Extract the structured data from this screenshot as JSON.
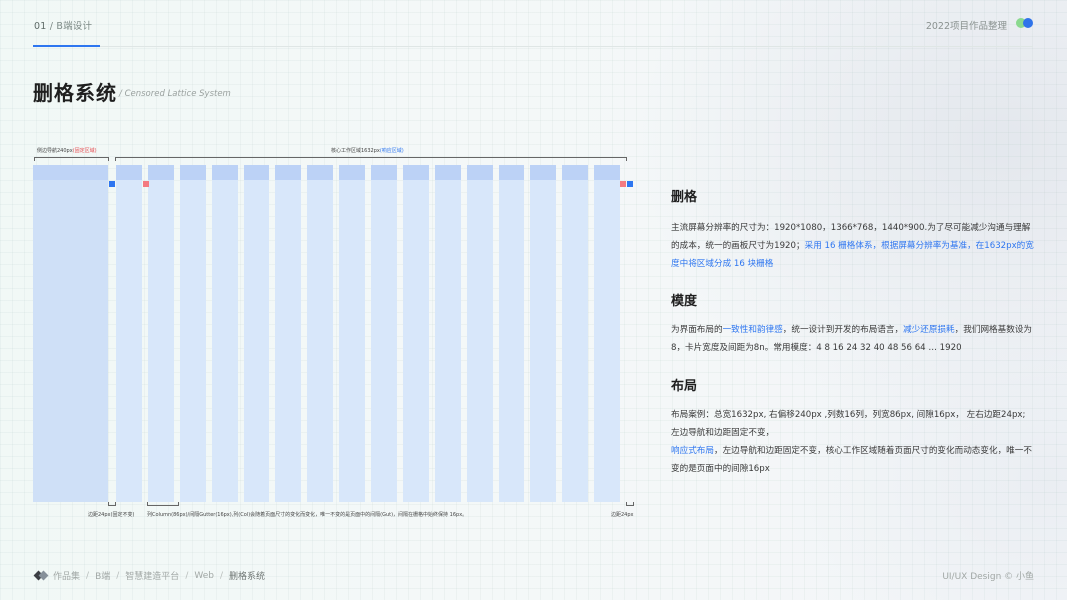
{
  "header": {
    "section_num": "01",
    "section_sep": "/",
    "section_name": "B端设计",
    "project": "2022项目作品整理",
    "accent_color": "#2e76f0"
  },
  "title": {
    "main": "删格系统",
    "sub": "/ Censored Lattice System"
  },
  "diagram": {
    "sidebar_label": "侧边导航240px",
    "sidebar_tag": "(固定区域)",
    "core_label": "核心工作区域1632px",
    "core_tag": "(响应区域)",
    "margin_left_label": "边距24px(固定不变)",
    "column_note": "列Column(86px)/间隔Gutter(16px),列(Col)会随着页面尺寸的变化而变化，唯一不变的是页面中的间隔(Gut)，间隔在栅格中始终保持 16px。",
    "margin_right_label": "边距24px",
    "columns": 16,
    "colors": {
      "sidebar": "#cfe0f7",
      "column": "#d8e7fa",
      "header": "#bcd2f6",
      "marker_blue": "#2e76f0",
      "marker_red": "#f47a80"
    }
  },
  "sections": [
    {
      "title": "删格",
      "p1": "主流屏幕分辨率的尺寸为：1920*1080，1366*768，1440*900.为了尽可能减少沟通与理解的成本，统一的画板尺寸为1920；",
      "p1_hl": "采用 16 栅格体系，根据屏幕分辨率为基准，在1632px的宽度中将区域分成 16 块栅格"
    },
    {
      "title": "模度",
      "p1": "为界面布局的",
      "p1_hl": "一致性和韵律感",
      "p2": "，统一设计到开发的布局语言，",
      "p2_hl": "减少还原损耗",
      "p3": "，我们网格基数设为8，卡片宽度及间距为8n。常用模度：4 8  16  24  32  40   48  56  64   …  1920"
    },
    {
      "title": "布局",
      "p1": "布局案例：总宽1632px, 右偏移240px ,列数16列，列宽86px, 间隙16px，  左右边距24px; 左边导航和边距固定不变，",
      "p2_hl": "响应式布局",
      "p2": "，左边导航和边距固定不变，核心工作区域随着页面尺寸的变化而动态变化，唯一不变的是页面中的间隙16px"
    }
  ],
  "footer": {
    "crumbs": [
      "作品集",
      "B端",
      "智慧建造平台",
      "Web",
      "删格系统"
    ],
    "sep": "/",
    "credit": "UI/UX Design © 小鱼"
  }
}
